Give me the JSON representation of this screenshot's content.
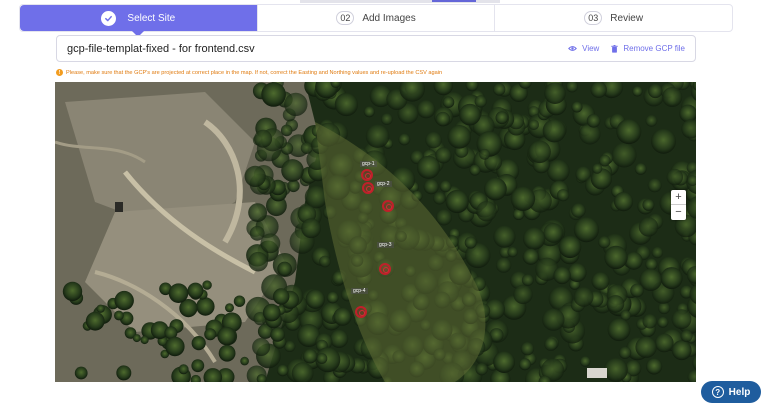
{
  "stepper": {
    "steps": [
      {
        "label": "Select Site",
        "number": "",
        "active": true
      },
      {
        "label": "Add Images",
        "number": "02",
        "active": false
      },
      {
        "label": "Review",
        "number": "03",
        "active": false
      }
    ]
  },
  "file": {
    "name": "gcp-file-templat-fixed - for frontend.csv",
    "view_label": "View",
    "remove_label": "Remove GCP file"
  },
  "warning": {
    "icon": "info-icon",
    "text": "Please, make sure that the GCP's are projected at correct place in the map. If not, correct the Easting and Northing values and re-upload the CSV again"
  },
  "map": {
    "zoom_in": "+",
    "zoom_out": "−",
    "gcp_labels": [
      "gcp-1",
      "gcp-2",
      "gcp-3",
      "gcp-4",
      "gcp-5",
      "gcp-6"
    ]
  },
  "help": {
    "label": "Help"
  },
  "colors": {
    "accent": "#6f6fe9",
    "warning": "#e07b10",
    "help_bg": "#1f5d9e",
    "marker": "#c0202a"
  }
}
